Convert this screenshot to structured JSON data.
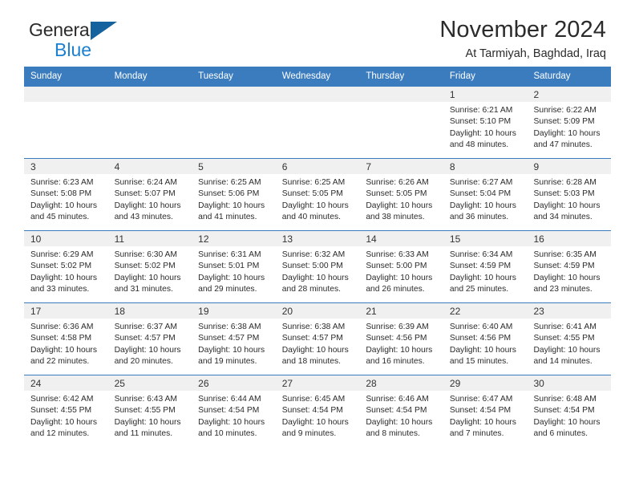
{
  "brand": {
    "name_part1": "General",
    "name_part2": "Blue"
  },
  "header": {
    "title": "November 2024",
    "location": "At Tarmiyah, Baghdad, Iraq"
  },
  "colors": {
    "header_blue": "#3b7cbf",
    "logo_blue": "#1c80d0",
    "day_band": "#f0f0f0"
  },
  "weekdays": [
    "Sunday",
    "Monday",
    "Tuesday",
    "Wednesday",
    "Thursday",
    "Friday",
    "Saturday"
  ],
  "weeks": [
    [
      {
        "day": "",
        "sunrise": "",
        "sunset": "",
        "daylight": ""
      },
      {
        "day": "",
        "sunrise": "",
        "sunset": "",
        "daylight": ""
      },
      {
        "day": "",
        "sunrise": "",
        "sunset": "",
        "daylight": ""
      },
      {
        "day": "",
        "sunrise": "",
        "sunset": "",
        "daylight": ""
      },
      {
        "day": "",
        "sunrise": "",
        "sunset": "",
        "daylight": ""
      },
      {
        "day": "1",
        "sunrise": "Sunrise: 6:21 AM",
        "sunset": "Sunset: 5:10 PM",
        "daylight": "Daylight: 10 hours and 48 minutes."
      },
      {
        "day": "2",
        "sunrise": "Sunrise: 6:22 AM",
        "sunset": "Sunset: 5:09 PM",
        "daylight": "Daylight: 10 hours and 47 minutes."
      }
    ],
    [
      {
        "day": "3",
        "sunrise": "Sunrise: 6:23 AM",
        "sunset": "Sunset: 5:08 PM",
        "daylight": "Daylight: 10 hours and 45 minutes."
      },
      {
        "day": "4",
        "sunrise": "Sunrise: 6:24 AM",
        "sunset": "Sunset: 5:07 PM",
        "daylight": "Daylight: 10 hours and 43 minutes."
      },
      {
        "day": "5",
        "sunrise": "Sunrise: 6:25 AM",
        "sunset": "Sunset: 5:06 PM",
        "daylight": "Daylight: 10 hours and 41 minutes."
      },
      {
        "day": "6",
        "sunrise": "Sunrise: 6:25 AM",
        "sunset": "Sunset: 5:05 PM",
        "daylight": "Daylight: 10 hours and 40 minutes."
      },
      {
        "day": "7",
        "sunrise": "Sunrise: 6:26 AM",
        "sunset": "Sunset: 5:05 PM",
        "daylight": "Daylight: 10 hours and 38 minutes."
      },
      {
        "day": "8",
        "sunrise": "Sunrise: 6:27 AM",
        "sunset": "Sunset: 5:04 PM",
        "daylight": "Daylight: 10 hours and 36 minutes."
      },
      {
        "day": "9",
        "sunrise": "Sunrise: 6:28 AM",
        "sunset": "Sunset: 5:03 PM",
        "daylight": "Daylight: 10 hours and 34 minutes."
      }
    ],
    [
      {
        "day": "10",
        "sunrise": "Sunrise: 6:29 AM",
        "sunset": "Sunset: 5:02 PM",
        "daylight": "Daylight: 10 hours and 33 minutes."
      },
      {
        "day": "11",
        "sunrise": "Sunrise: 6:30 AM",
        "sunset": "Sunset: 5:02 PM",
        "daylight": "Daylight: 10 hours and 31 minutes."
      },
      {
        "day": "12",
        "sunrise": "Sunrise: 6:31 AM",
        "sunset": "Sunset: 5:01 PM",
        "daylight": "Daylight: 10 hours and 29 minutes."
      },
      {
        "day": "13",
        "sunrise": "Sunrise: 6:32 AM",
        "sunset": "Sunset: 5:00 PM",
        "daylight": "Daylight: 10 hours and 28 minutes."
      },
      {
        "day": "14",
        "sunrise": "Sunrise: 6:33 AM",
        "sunset": "Sunset: 5:00 PM",
        "daylight": "Daylight: 10 hours and 26 minutes."
      },
      {
        "day": "15",
        "sunrise": "Sunrise: 6:34 AM",
        "sunset": "Sunset: 4:59 PM",
        "daylight": "Daylight: 10 hours and 25 minutes."
      },
      {
        "day": "16",
        "sunrise": "Sunrise: 6:35 AM",
        "sunset": "Sunset: 4:59 PM",
        "daylight": "Daylight: 10 hours and 23 minutes."
      }
    ],
    [
      {
        "day": "17",
        "sunrise": "Sunrise: 6:36 AM",
        "sunset": "Sunset: 4:58 PM",
        "daylight": "Daylight: 10 hours and 22 minutes."
      },
      {
        "day": "18",
        "sunrise": "Sunrise: 6:37 AM",
        "sunset": "Sunset: 4:57 PM",
        "daylight": "Daylight: 10 hours and 20 minutes."
      },
      {
        "day": "19",
        "sunrise": "Sunrise: 6:38 AM",
        "sunset": "Sunset: 4:57 PM",
        "daylight": "Daylight: 10 hours and 19 minutes."
      },
      {
        "day": "20",
        "sunrise": "Sunrise: 6:38 AM",
        "sunset": "Sunset: 4:57 PM",
        "daylight": "Daylight: 10 hours and 18 minutes."
      },
      {
        "day": "21",
        "sunrise": "Sunrise: 6:39 AM",
        "sunset": "Sunset: 4:56 PM",
        "daylight": "Daylight: 10 hours and 16 minutes."
      },
      {
        "day": "22",
        "sunrise": "Sunrise: 6:40 AM",
        "sunset": "Sunset: 4:56 PM",
        "daylight": "Daylight: 10 hours and 15 minutes."
      },
      {
        "day": "23",
        "sunrise": "Sunrise: 6:41 AM",
        "sunset": "Sunset: 4:55 PM",
        "daylight": "Daylight: 10 hours and 14 minutes."
      }
    ],
    [
      {
        "day": "24",
        "sunrise": "Sunrise: 6:42 AM",
        "sunset": "Sunset: 4:55 PM",
        "daylight": "Daylight: 10 hours and 12 minutes."
      },
      {
        "day": "25",
        "sunrise": "Sunrise: 6:43 AM",
        "sunset": "Sunset: 4:55 PM",
        "daylight": "Daylight: 10 hours and 11 minutes."
      },
      {
        "day": "26",
        "sunrise": "Sunrise: 6:44 AM",
        "sunset": "Sunset: 4:54 PM",
        "daylight": "Daylight: 10 hours and 10 minutes."
      },
      {
        "day": "27",
        "sunrise": "Sunrise: 6:45 AM",
        "sunset": "Sunset: 4:54 PM",
        "daylight": "Daylight: 10 hours and 9 minutes."
      },
      {
        "day": "28",
        "sunrise": "Sunrise: 6:46 AM",
        "sunset": "Sunset: 4:54 PM",
        "daylight": "Daylight: 10 hours and 8 minutes."
      },
      {
        "day": "29",
        "sunrise": "Sunrise: 6:47 AM",
        "sunset": "Sunset: 4:54 PM",
        "daylight": "Daylight: 10 hours and 7 minutes."
      },
      {
        "day": "30",
        "sunrise": "Sunrise: 6:48 AM",
        "sunset": "Sunset: 4:54 PM",
        "daylight": "Daylight: 10 hours and 6 minutes."
      }
    ]
  ]
}
